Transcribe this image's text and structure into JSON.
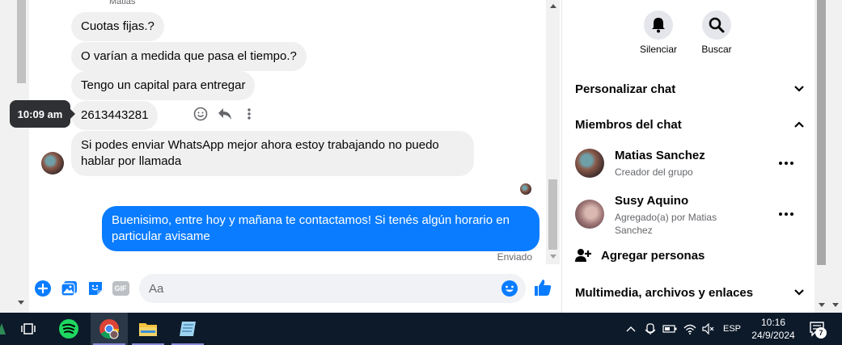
{
  "chat": {
    "sender_name": "Matias",
    "tooltip_time": "10:09 am",
    "messages": [
      {
        "text": "Cuotas fijas.?"
      },
      {
        "text": "O varían a medida que pasa el tiempo.?"
      },
      {
        "text": "Tengo un capital para entregar"
      },
      {
        "text": "2613443281"
      },
      {
        "text": "Si podes enviar WhatsApp mejor ahora estoy trabajando no puedo hablar por llamada"
      }
    ],
    "outgoing": {
      "text": "Buenisimo, entre hoy y mañana te contactamos! Si tenés algún horario en particular avisame",
      "status": "Enviado"
    }
  },
  "composer": {
    "placeholder": "Aa",
    "gif_label": "GIF"
  },
  "sidebar": {
    "actions": [
      {
        "label": "Silenciar",
        "icon": "bell-icon"
      },
      {
        "label": "Buscar",
        "icon": "search-icon"
      }
    ],
    "customize_label": "Personalizar chat",
    "members_label": "Miembros del chat",
    "members": [
      {
        "name": "Matias Sanchez",
        "sub": "Creador del grupo"
      },
      {
        "name": "Susy Aquino",
        "sub": "Agregado(a) por Matias Sanchez"
      }
    ],
    "add_people_label": "Agregar personas",
    "media_label": "Multimedia, archivos y enlaces"
  },
  "taskbar": {
    "language": "ESP",
    "time": "10:16",
    "date": "24/9/2024",
    "notification_count": "7"
  },
  "colors": {
    "accent": "#0a7cff",
    "taskbar": "#0c1a2a"
  }
}
